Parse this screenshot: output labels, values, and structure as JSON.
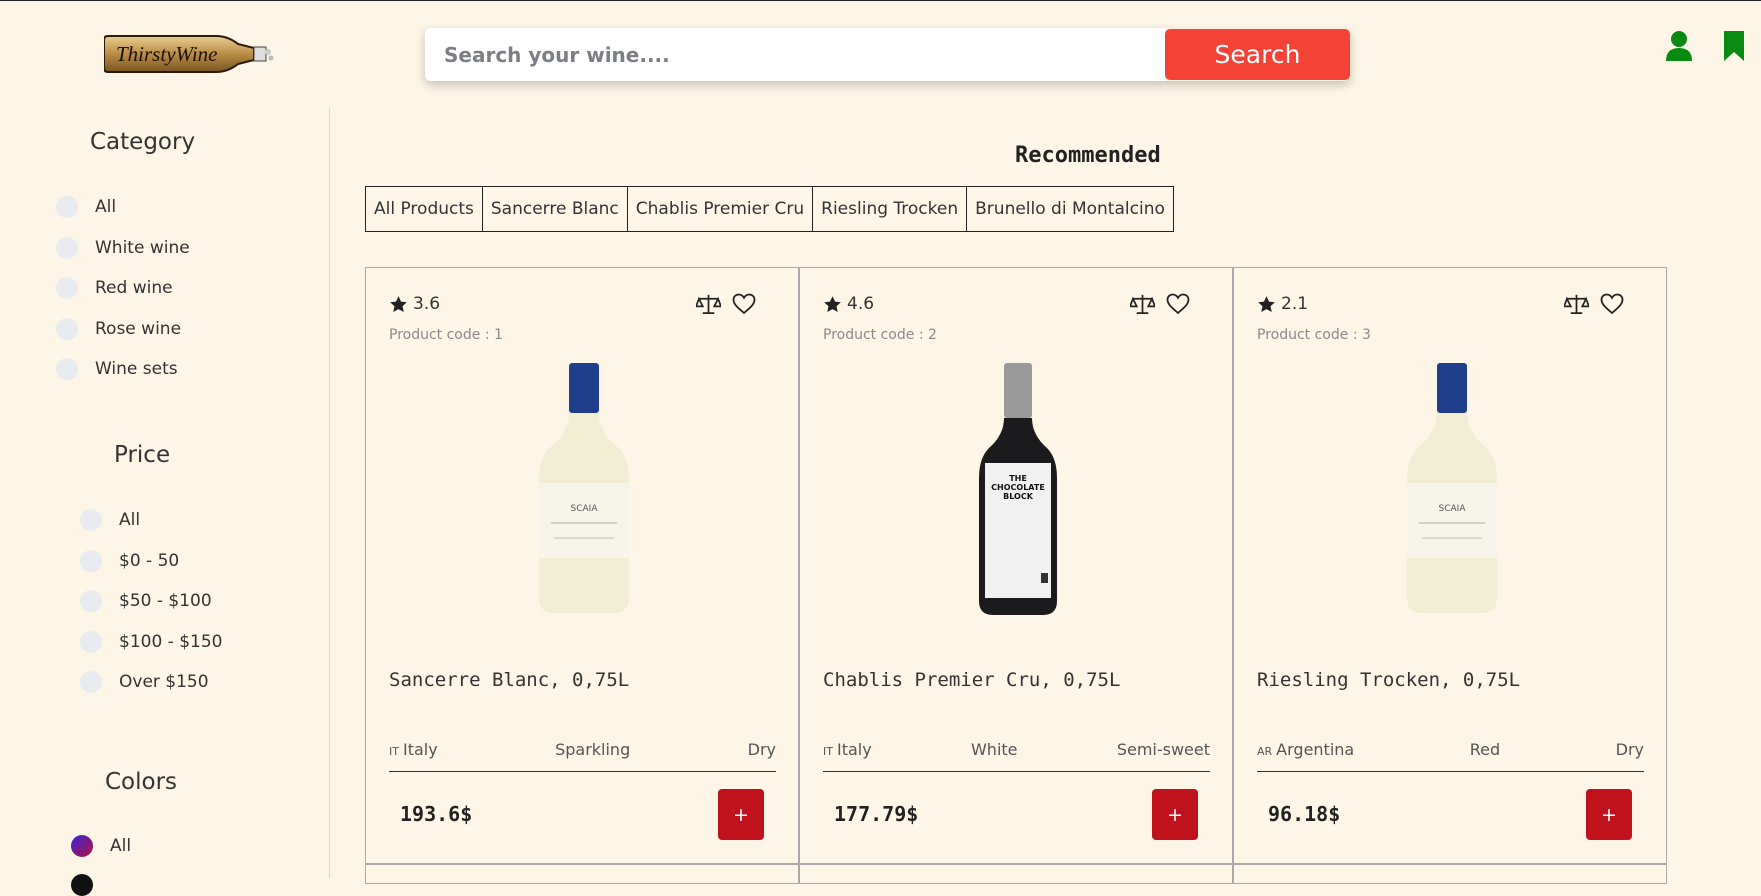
{
  "header": {
    "logo_text": "ThirstyWine",
    "search_placeholder": "Search your wine....",
    "search_label": "Search"
  },
  "sidebar": {
    "category": {
      "title": "Category",
      "options": [
        "All",
        "White wine",
        "Red wine",
        "Rose wine",
        "Wine sets"
      ]
    },
    "price": {
      "title": "Price",
      "options": [
        "All",
        "$0 - 50",
        "$50 - $100",
        "$100 - $150",
        "Over $150"
      ]
    },
    "colors": {
      "title": "Colors",
      "options": [
        "All"
      ]
    }
  },
  "main": {
    "section_title": "Recommended",
    "tabs": [
      "All Products",
      "Sancerre Blanc",
      "Chablis Premier Cru",
      "Riesling Trocken",
      "Brunello di Montalcino"
    ],
    "products": [
      {
        "rating": "3.6",
        "code": "Product code : 1",
        "name": "Sancerre Blanc, 0,75L",
        "country_code": "IT",
        "country": "Italy",
        "type": "Sparkling",
        "sweetness": "Dry",
        "price": "193.6$",
        "add_label": "+",
        "bottle": "white"
      },
      {
        "rating": "4.6",
        "code": "Product code : 2",
        "name": "Chablis Premier Cru, 0,75L",
        "country_code": "IT",
        "country": "Italy",
        "type": "White",
        "sweetness": "Semi-sweet",
        "price": "177.79$",
        "add_label": "+",
        "bottle": "dark"
      },
      {
        "rating": "2.1",
        "code": "Product code : 3",
        "name": "Riesling Trocken, 0,75L",
        "country_code": "AR",
        "country": "Argentina",
        "type": "Red",
        "sweetness": "Dry",
        "price": "96.18$",
        "add_label": "+",
        "bottle": "white"
      }
    ]
  },
  "colors": {
    "accent": "#f44336",
    "add_button": "#c0121c",
    "icon_green": "#0a8a12",
    "background": "#fdf6e7"
  }
}
